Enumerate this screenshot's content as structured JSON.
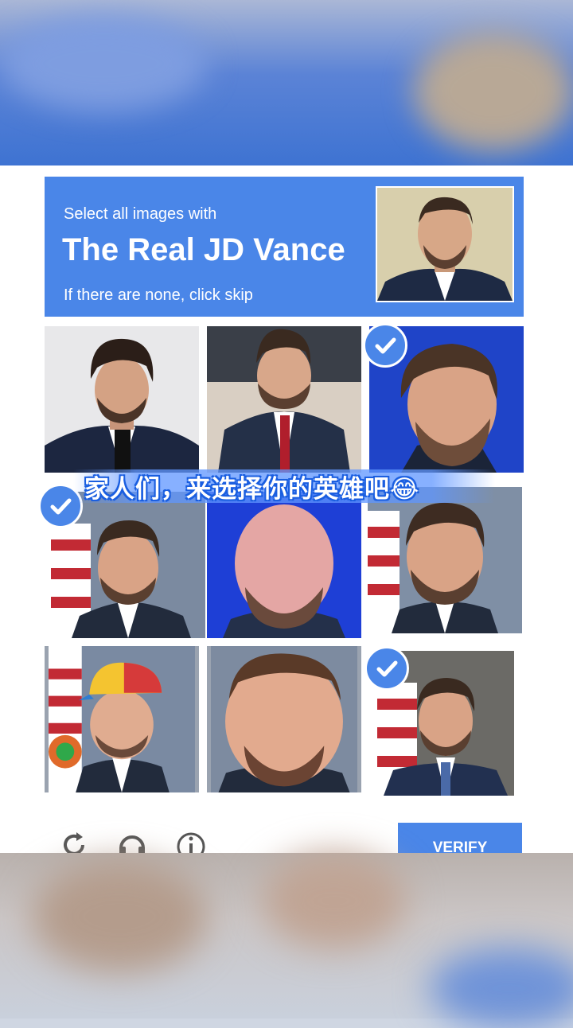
{
  "captcha": {
    "instruction": "Select all images with",
    "target": "The Real JD Vance",
    "hint": "If there are none, click skip",
    "verify_label": "VERIFY"
  },
  "tiles": [
    {
      "selected": false
    },
    {
      "selected": false
    },
    {
      "selected": true
    },
    {
      "selected": true
    },
    {
      "selected": false
    },
    {
      "selected": false
    },
    {
      "selected": false
    },
    {
      "selected": false
    },
    {
      "selected": true
    }
  ],
  "overlay": {
    "caption": "家人们，来选择你的英雄吧😂"
  },
  "footer": {
    "icons": [
      "reload-icon",
      "headphones-icon",
      "info-icon"
    ]
  },
  "colors": {
    "accent": "#4a86e8",
    "white": "#ffffff"
  }
}
